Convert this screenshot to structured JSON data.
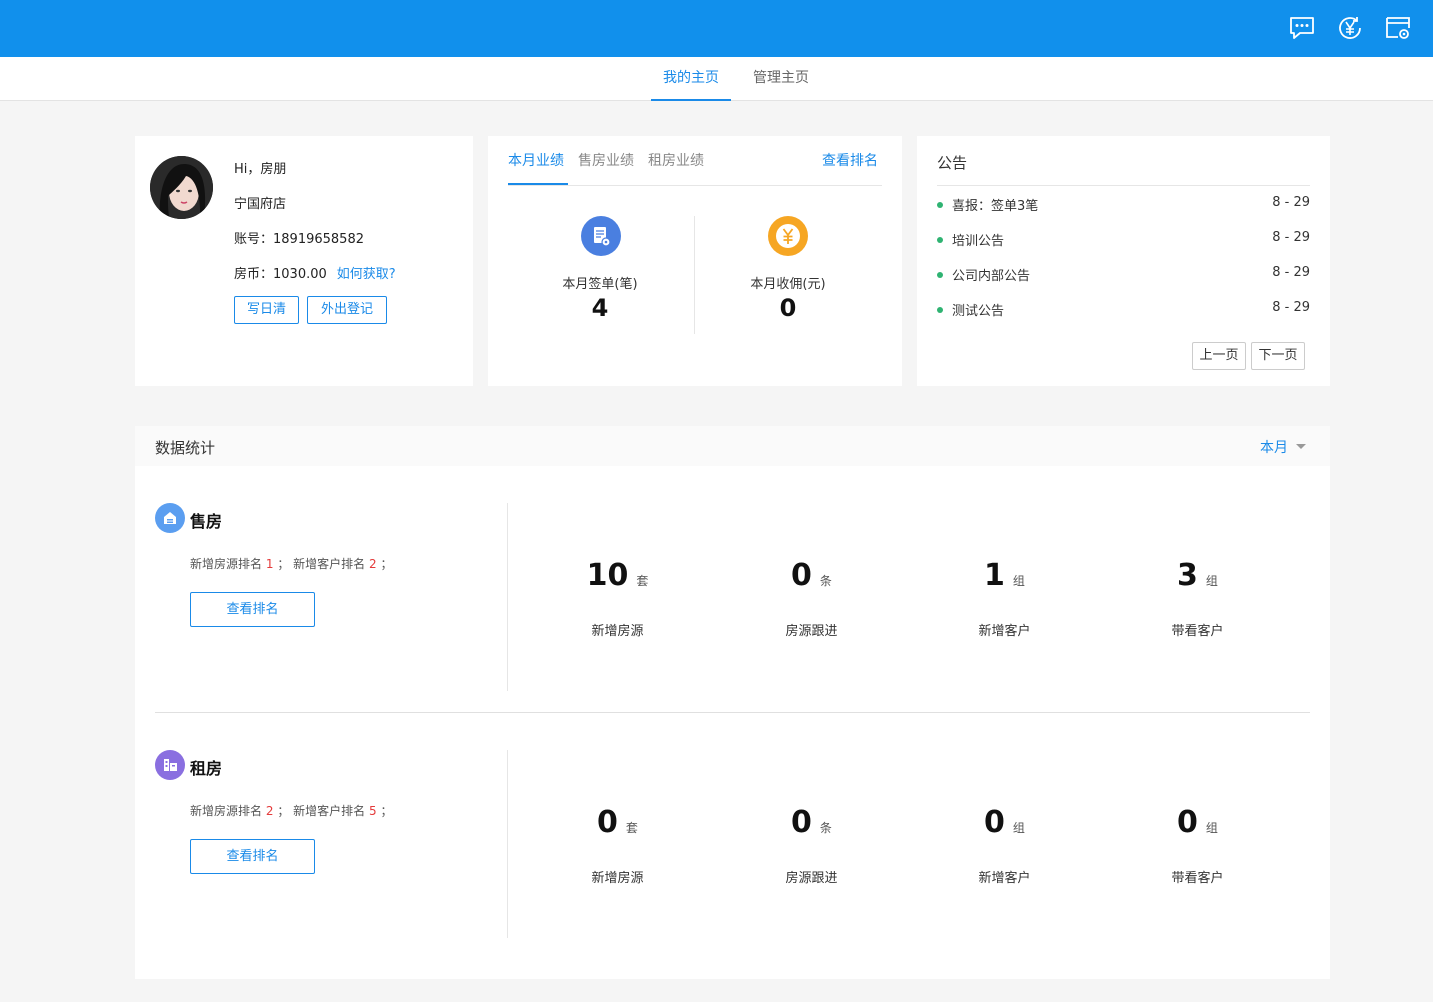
{
  "topbar": {
    "icons": [
      "chat-icon",
      "yen-refresh-icon",
      "settings-window-icon"
    ],
    "color": "#1190ec"
  },
  "main_tabs": [
    {
      "label": "我的主页",
      "active": true
    },
    {
      "label": "管理主页",
      "active": false
    }
  ],
  "profile": {
    "greeting": "Hi，房朋",
    "store": "宁国府店",
    "account_label": "账号：",
    "account": "18919658582",
    "coins_label": "房币：",
    "coins": "1030.00",
    "coins_link": "如何获取?",
    "btn_daily": "写日清",
    "btn_outing": "外出登记"
  },
  "performance": {
    "tabs": [
      {
        "label": "本月业绩",
        "active": true
      },
      {
        "label": "售房业绩",
        "active": false
      },
      {
        "label": "租房业绩",
        "active": false
      }
    ],
    "rank_link": "查看排名",
    "stats": [
      {
        "label": "本月签单(笔)",
        "value": "4",
        "icon": "contract-icon",
        "color": "#4a7fe0"
      },
      {
        "label": "本月收佣(元)",
        "value": "0",
        "icon": "yen-coin-icon",
        "color": "#f6a623"
      }
    ]
  },
  "notices": {
    "title": "公告",
    "items": [
      {
        "text": "喜报：签单3笔",
        "date": "8 - 29"
      },
      {
        "text": "培训公告",
        "date": "8 - 29"
      },
      {
        "text": "公司内部公告",
        "date": "8 - 29"
      },
      {
        "text": "测试公告",
        "date": "8 - 29"
      }
    ],
    "prev": "上一页",
    "next": "下一页"
  },
  "data_stats": {
    "title": "数据统计",
    "period": "本月",
    "sections": [
      {
        "title": "售房",
        "icon": "house-sale-icon",
        "icon_color": "#5b9ef0",
        "rank_prefix": "新增房源排名",
        "rank_house": "1",
        "rank_mid": "；  新增客户排名",
        "rank_customer": "2",
        "rank_suffix": "；",
        "rank_button": "查看排名",
        "metrics": [
          {
            "value": "10",
            "unit": "套",
            "label": "新增房源"
          },
          {
            "value": "0",
            "unit": "条",
            "label": "房源跟进"
          },
          {
            "value": "1",
            "unit": "组",
            "label": "新增客户"
          },
          {
            "value": "3",
            "unit": "组",
            "label": "带看客户"
          }
        ]
      },
      {
        "title": "租房",
        "icon": "house-rent-icon",
        "icon_color": "#8a6fe0",
        "rank_prefix": "新增房源排名",
        "rank_house": "2",
        "rank_mid": "；  新增客户排名",
        "rank_customer": "5",
        "rank_suffix": "；",
        "rank_button": "查看排名",
        "metrics": [
          {
            "value": "0",
            "unit": "套",
            "label": "新增房源"
          },
          {
            "value": "0",
            "unit": "条",
            "label": "房源跟进"
          },
          {
            "value": "0",
            "unit": "组",
            "label": "新增客户"
          },
          {
            "value": "0",
            "unit": "组",
            "label": "带看客户"
          }
        ]
      }
    ]
  }
}
